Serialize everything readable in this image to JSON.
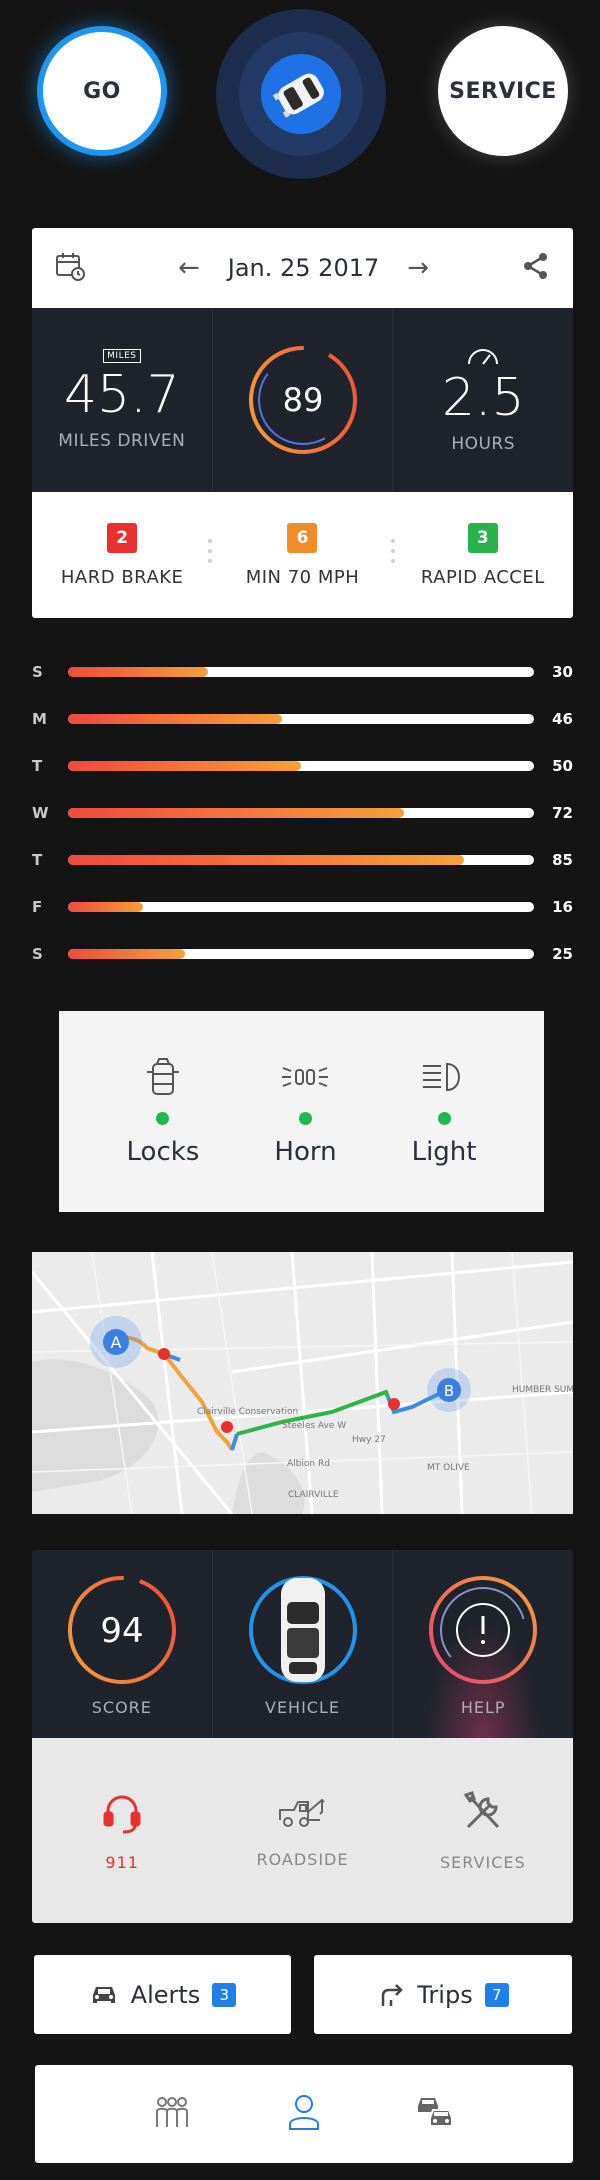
{
  "top": {
    "go_label": "GO",
    "service_label": "SERVICE"
  },
  "trip": {
    "date": "Jan. 25 2017",
    "miles_tag": "MILES",
    "miles_value": "45.7",
    "miles_label": "MILES DRIVEN",
    "score": "89",
    "hours_value": "2.5",
    "hours_label": "HOURS",
    "events": [
      {
        "count": "2",
        "label": "HARD BRAKE",
        "color": "#e8302f"
      },
      {
        "count": "6",
        "label": "MIN 70 MPH",
        "color": "#f38b26"
      },
      {
        "count": "3",
        "label": "RAPID ACCEL",
        "color": "#27b24a"
      }
    ]
  },
  "week": [
    {
      "day": "S",
      "value": 30
    },
    {
      "day": "M",
      "value": 46
    },
    {
      "day": "T",
      "value": 50
    },
    {
      "day": "W",
      "value": 72
    },
    {
      "day": "T",
      "value": 85
    },
    {
      "day": "F",
      "value": 16
    },
    {
      "day": "S",
      "value": 25
    }
  ],
  "controls": [
    {
      "label": "Locks"
    },
    {
      "label": "Horn"
    },
    {
      "label": "Light"
    }
  ],
  "map": {
    "marker_a": "A",
    "marker_b": "B",
    "places": [
      "Clairville Conservation",
      "CLAIRVILLE",
      "HUMBER SUMMIT",
      "MT OLIVE",
      "Albion Rd",
      "Steeles Ave W",
      "Hwy 27"
    ]
  },
  "dash": {
    "score_value": "94",
    "score_label": "SCORE",
    "vehicle_label": "VEHICLE",
    "help_label": "HELP",
    "emergency_label": "911",
    "roadside_label": "ROADSIDE",
    "services_label": "SERVICES"
  },
  "buttons": {
    "alerts_label": "Alerts",
    "alerts_count": "3",
    "trips_label": "Trips",
    "trips_count": "7"
  },
  "colors": {
    "accent_blue": "#1e96f0",
    "brand_orange": "#f5a13a",
    "status_green": "#1fba4f",
    "alert_red": "#e8302f"
  }
}
